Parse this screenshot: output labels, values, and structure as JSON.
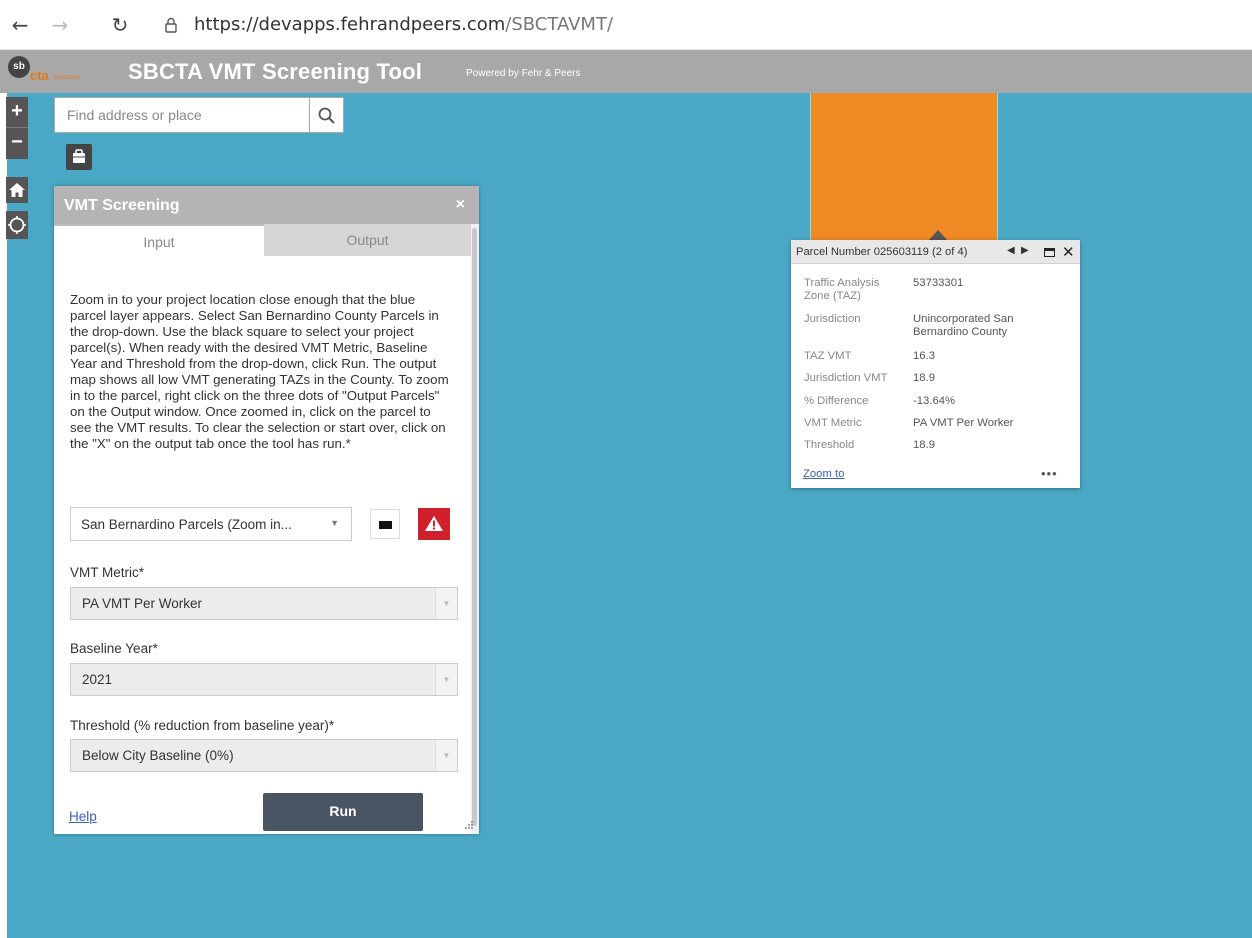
{
  "browser": {
    "back_icon": "arrow-left-icon",
    "forward_icon": "arrow-right-icon",
    "reload_icon": "reload-icon",
    "url_host": "https://devapps.fehrandpeers.com",
    "url_path": "/SBCTAVMT/"
  },
  "header": {
    "logo_sb": "sb",
    "logo_cta": "cta",
    "logo_sub": "education",
    "title": "SBCTA VMT Screening Tool",
    "powered_by": "Powered by Fehr & Peers",
    "bg_color": "#a8a8a8"
  },
  "map": {
    "bg_color": "#4aa8c6",
    "parcel_color": "#f08a24",
    "controls": {
      "zoom_in": "+",
      "zoom_out": "−"
    }
  },
  "search": {
    "placeholder": "Find address or place"
  },
  "panel": {
    "title": "VMT Screening",
    "close": "×",
    "tabs": [
      "Input",
      "Output"
    ],
    "instructions": "Zoom in to your project location close enough that the blue parcel layer appears. Select San Bernardino County Parcels in the drop-down. Use the black square to select your project parcel(s). When ready with the desired VMT Metric, Baseline Year and Threshold from the drop-down, click Run. The output map shows all low VMT generating TAZs in the County. To zoom in to the parcel, right click on the three dots of \"Output Parcels\" on the Output window. Once zoomed in, click on the parcel to see the VMT results. To clear the selection or start over, click on the \"X\" on the output tab once the tool has run.*",
    "layer_select": "San Bernardino Parcels (Zoom in...",
    "fields": [
      {
        "label": "VMT Metric*",
        "value": "PA VMT Per Worker"
      },
      {
        "label": "Baseline Year*",
        "value": "2021"
      },
      {
        "label": "Threshold (% reduction from baseline year)*",
        "value": "Below City Baseline (0%)"
      }
    ],
    "help": "Help",
    "run": "Run",
    "run_color": "#4a5563",
    "warn_color": "#d0202c"
  },
  "popup": {
    "title": "Parcel Number 025603119 (2 of 4)",
    "rows": [
      {
        "key": "Traffic Analysis Zone (TAZ)",
        "value": "53733301"
      },
      {
        "key": "Jurisdiction",
        "value": "Unincorporated San Bernardino County"
      },
      {
        "key": "TAZ VMT",
        "value": "16.3"
      },
      {
        "key": "Jurisdiction VMT",
        "value": "18.9"
      },
      {
        "key": "% Difference",
        "value": "-13.64%"
      },
      {
        "key": "VMT Metric",
        "value": "PA VMT Per Worker"
      },
      {
        "key": "Threshold",
        "value": "18.9"
      }
    ],
    "zoom_to": "Zoom to",
    "more": "•••"
  }
}
